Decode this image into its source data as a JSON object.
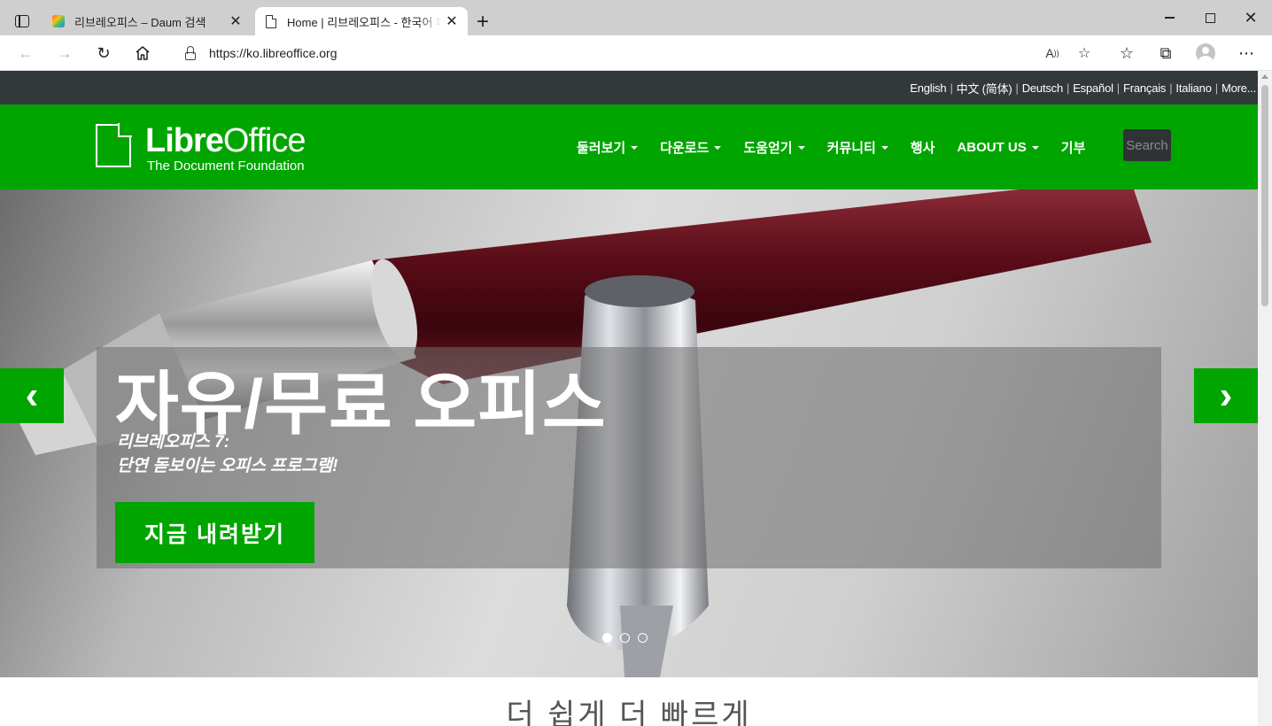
{
  "browser": {
    "tabs": [
      {
        "title": "리브레오피스 – Daum 검색",
        "favicon": "daum-logo-icon"
      },
      {
        "title": "Home | 리브레오피스 - 한국어 페이지",
        "favicon": "document-icon"
      }
    ],
    "url_host": "https://ko.libreoffice.org",
    "accent": "#00a500"
  },
  "site": {
    "languages": [
      "English",
      "中文 (简体)",
      "Deutsch",
      "Español",
      "Français",
      "Italiano",
      "More..."
    ],
    "logo": {
      "name_bold": "Libre",
      "name_light": "Office",
      "subtitle": "The Document Foundation"
    },
    "menu": [
      {
        "label": "둘러보기",
        "dropdown": true
      },
      {
        "label": "다운로드",
        "dropdown": true
      },
      {
        "label": "도움얻기",
        "dropdown": true
      },
      {
        "label": "커뮤니티",
        "dropdown": true
      },
      {
        "label": "행사",
        "dropdown": false
      },
      {
        "label": "ABOUT US",
        "dropdown": true
      },
      {
        "label": "기부",
        "dropdown": false
      }
    ],
    "search_placeholder": "Search",
    "hero": {
      "title": "자유/무료 오피스",
      "subtitle_line1": "리브레오피스 7:",
      "subtitle_line2": "단연 돋보이는 오피스 프로그램!",
      "button": "지금 내려받기",
      "prev": "‹",
      "next": "›",
      "slides": 3,
      "active_slide": 1
    },
    "tagline": "더 쉽게 더 빠르게"
  }
}
